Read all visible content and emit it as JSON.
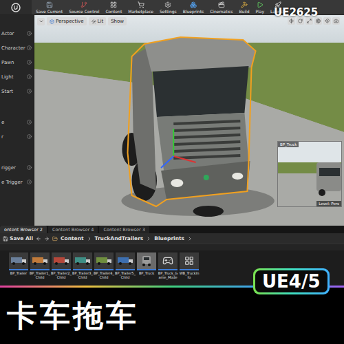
{
  "window": {
    "watermark": "UE2625"
  },
  "toolbar": {
    "buttons": [
      "Save Current",
      "Source Control",
      "Content",
      "Marketplace",
      "Settings",
      "Blueprints",
      "Cinematics",
      "Build",
      "Play",
      "Launch"
    ]
  },
  "place_panel": {
    "groups": [
      {
        "items": [
          "Actor",
          "Character",
          "Pawn",
          "Light",
          "Start"
        ]
      },
      {
        "items": [
          "e",
          "r"
        ]
      },
      {
        "items": [
          "rigger",
          "e Trigger"
        ]
      }
    ]
  },
  "viewport": {
    "buttons": [
      "Perspective",
      "Lit",
      "Show"
    ],
    "preview": {
      "title": "BP_Truck",
      "level": "Level: Pers"
    }
  },
  "content_browser": {
    "tabs": [
      {
        "label": "ontent Browser 2",
        "selected": true
      },
      {
        "label": "Content Browser 4",
        "selected": false
      },
      {
        "label": "Content Browser 3",
        "selected": false
      }
    ],
    "save_all": "Save All",
    "path": [
      "Content",
      "TruckAndTrailers",
      "Blueprints"
    ],
    "assets": [
      {
        "name": "BP_Trailer",
        "kind": "trailer",
        "color": "#6a7f9a",
        "selected": false
      },
      {
        "name": "BP_Trailer1_Child",
        "kind": "trailer",
        "color": "#c07a3a",
        "selected": false
      },
      {
        "name": "BP_Trailer2_Child",
        "kind": "trailer",
        "color": "#b5473a",
        "selected": false
      },
      {
        "name": "BP_Trailer3_Child",
        "kind": "trailer",
        "color": "#3f8f86",
        "selected": false
      },
      {
        "name": "BP_Trailer4_Child",
        "kind": "trailer",
        "color": "#6f8f3f",
        "selected": false
      },
      {
        "name": "BP_Trailer5_Child",
        "kind": "trailer",
        "color": "#3d6fb0",
        "selected": false
      },
      {
        "name": "BP_Truck",
        "kind": "truck",
        "color": "#9a9a9a",
        "selected": true
      },
      {
        "name": "BP_Truck_Game_Mode",
        "kind": "gamemode",
        "color": "#cfcfcf",
        "selected": false
      },
      {
        "name": "WB_TruckInfo",
        "kind": "widget",
        "color": "#dcdcdc",
        "selected": false
      }
    ]
  },
  "banner": {
    "title": "卡车拖车",
    "badge": "UE4/5"
  }
}
